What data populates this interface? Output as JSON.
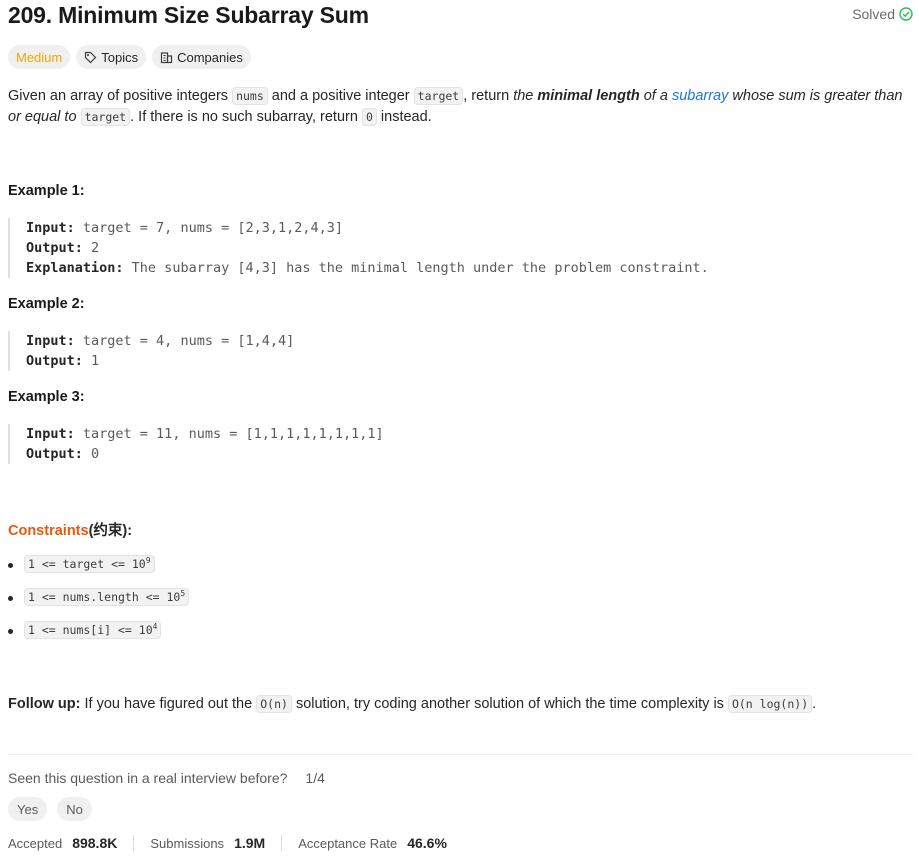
{
  "title": "209. Minimum Size Subarray Sum",
  "status": "Solved",
  "tags": {
    "difficulty": "Medium",
    "topics": "Topics",
    "companies": "Companies"
  },
  "description": {
    "p1": "Given an array of positive integers ",
    "c1": "nums",
    "p2": " and a positive integer ",
    "c2": "target",
    "p3": ", return ",
    "i1": "the ",
    "b1": "minimal length",
    "i2": " of a ",
    "link": "subarray",
    "i3": " whose sum is greater than or equal to ",
    "c3": "target",
    "p4": ". If there is no such subarray, return ",
    "c4": "0",
    "p5": " instead."
  },
  "examples": [
    {
      "heading": "Example 1:",
      "input_label": "Input:",
      "input": " target = 7, nums = [2,3,1,2,4,3]",
      "output_label": "Output:",
      "output": " 2",
      "explanation_label": "Explanation:",
      "explanation": " The subarray [4,3] has the minimal length under the problem constraint."
    },
    {
      "heading": "Example 2:",
      "input_label": "Input:",
      "input": " target = 4, nums = [1,4,4]",
      "output_label": "Output:",
      "output": " 1"
    },
    {
      "heading": "Example 3:",
      "input_label": "Input:",
      "input": " target = 11, nums = [1,1,1,1,1,1,1,1]",
      "output_label": "Output:",
      "output": " 0"
    }
  ],
  "constraints": {
    "heading": "Constraints",
    "heading_suffix": "(约束):",
    "items": [
      {
        "text": "1 <= target <= 10",
        "sup": "9"
      },
      {
        "text": "1 <= nums.length <= 10",
        "sup": "5"
      },
      {
        "text": "1 <= nums[i] <= 10",
        "sup": "4"
      }
    ]
  },
  "followup": {
    "label": "Follow up:",
    "t1": " If you have figured out the ",
    "c1": "O(n)",
    "t2": " solution, try coding another solution of which the time complexity is ",
    "c2": "O(n log(n))",
    "t3": "."
  },
  "interview": {
    "question": "Seen this question in a real interview before?",
    "count": "1/4",
    "yes": "Yes",
    "no": "No"
  },
  "stats": [
    {
      "label": "Accepted",
      "value": "898.8K"
    },
    {
      "label": "Submissions",
      "value": "1.9M"
    },
    {
      "label": "Acceptance Rate",
      "value": "46.6%"
    }
  ],
  "colors": {
    "difficulty_medium": "#f0a600",
    "solved_check": "#2cbb5d",
    "link": "#1a73e8",
    "constraints_heading": "#e8590c"
  }
}
